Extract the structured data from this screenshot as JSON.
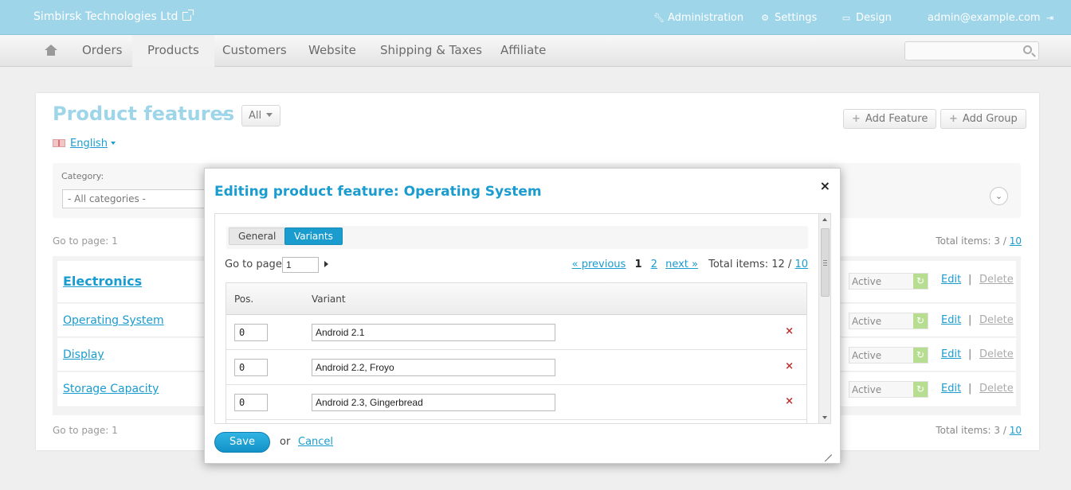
{
  "topbar": {
    "brand": "Simbirsk Technologies Ltd",
    "links": [
      {
        "label": "Administration",
        "icon": "wrench-icon"
      },
      {
        "label": "Settings",
        "icon": "gear-icon"
      },
      {
        "label": "Design",
        "icon": "monitor-icon"
      },
      {
        "label": "admin@example.com",
        "icon": "logout-icon"
      }
    ]
  },
  "nav": {
    "items": [
      "Orders",
      "Products",
      "Customers",
      "Website",
      "Shipping & Taxes",
      "Affiliate"
    ],
    "active": "Products",
    "search_placeholder": ""
  },
  "page": {
    "title": "Product features",
    "title_dash": "-",
    "filter_value": "All",
    "language": "English",
    "add_feature": "Add Feature",
    "add_group": "Add Group",
    "filter": {
      "category_label": "Category:",
      "category_value": "- All categories -"
    },
    "pagination": {
      "goto_label": "Go to page: 1",
      "total_label": "Total items: 3 /",
      "total_link": "10"
    },
    "rows": [
      {
        "name": "Electronics",
        "type": "group",
        "status": "Active",
        "edit": "Edit",
        "sep": "|",
        "delete": "Delete"
      },
      {
        "name": "Operating System",
        "type": "feature",
        "status": "Active",
        "edit": "Edit",
        "sep": "|",
        "delete": "Delete"
      },
      {
        "name": "Display",
        "type": "feature",
        "status": "Active",
        "edit": "Edit",
        "sep": "|",
        "delete": "Delete"
      },
      {
        "name": "Storage Capacity",
        "type": "feature",
        "status": "Active",
        "edit": "Edit",
        "sep": "|",
        "delete": "Delete"
      }
    ]
  },
  "modal": {
    "title": "Editing product feature: Operating System",
    "close": "×",
    "tabs": {
      "general": "General",
      "variants": "Variants",
      "active": "Variants"
    },
    "goto_label": "Go to page:",
    "goto_value": "1",
    "pager": {
      "previous": "« previous",
      "current": "1",
      "page2": "2",
      "next": "next »",
      "total_label": "Total items: 12 /",
      "total_link": "10"
    },
    "columns": {
      "pos": "Pos.",
      "variant": "Variant"
    },
    "variants": [
      {
        "pos": "0",
        "name": "Android 2.1"
      },
      {
        "pos": "0",
        "name": "Android 2.2, Froyo"
      },
      {
        "pos": "0",
        "name": "Android 2.3, Gingerbread"
      }
    ],
    "delete_mark": "×",
    "save": "Save",
    "or": "or",
    "cancel": "Cancel"
  },
  "colors": {
    "topbar": "#9fd5e9",
    "accent": "#1a9ccf",
    "delete": "#c03030",
    "status_ok": "#b7dd90"
  }
}
